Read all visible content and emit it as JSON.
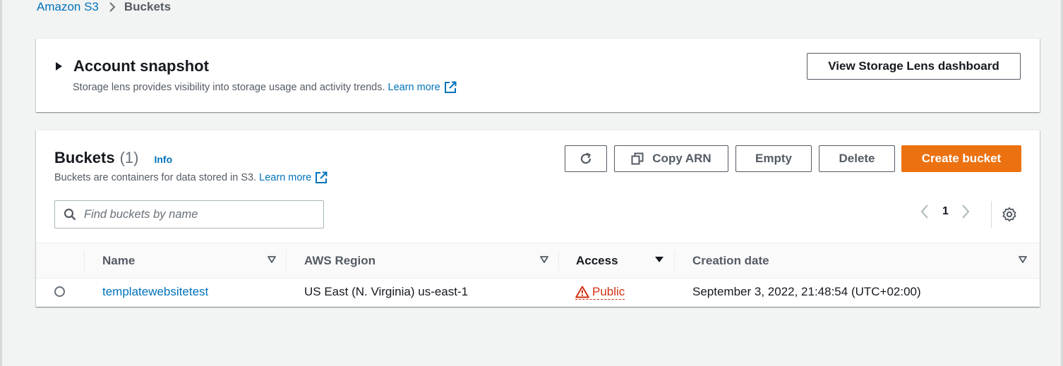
{
  "breadcrumb": {
    "root": "Amazon S3",
    "current": "Buckets"
  },
  "snapshot": {
    "title": "Account snapshot",
    "description": "Storage lens provides visibility into storage usage and activity trends.",
    "learn_more": "Learn more",
    "button": "View Storage Lens dashboard"
  },
  "buckets": {
    "title": "Buckets",
    "count": "(1)",
    "info": "Info",
    "description": "Buckets are containers for data stored in S3.",
    "learn_more": "Learn more",
    "actions": {
      "copy_arn": "Copy ARN",
      "empty": "Empty",
      "delete": "Delete",
      "create": "Create bucket"
    },
    "search_placeholder": "Find buckets by name",
    "page": "1",
    "columns": {
      "name": "Name",
      "region": "AWS Region",
      "access": "Access",
      "created": "Creation date"
    },
    "rows": [
      {
        "name": "templatewebsitetest",
        "region": "US East (N. Virginia) us-east-1",
        "access": "Public",
        "created": "September 3, 2022, 21:48:54 (UTC+02:00)"
      }
    ]
  },
  "colors": {
    "link": "#0073bb",
    "primary": "#ec7211",
    "warning": "#d13212",
    "background": "#f2f3f3"
  },
  "icons": [
    "chevron-right-icon",
    "caret-right-icon",
    "external-link-icon",
    "refresh-icon",
    "copy-icon",
    "search-icon",
    "chevron-left-icon",
    "chevron-right-icon",
    "settings-gear-icon",
    "sort-down-icon",
    "warning-triangle-icon"
  ]
}
